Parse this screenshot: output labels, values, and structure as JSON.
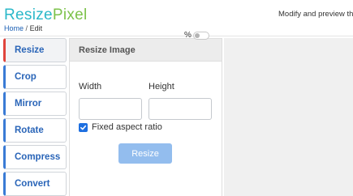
{
  "header": {
    "logo_part1": "Resize",
    "logo_part2": "Pixel",
    "tagline": "Modify and preview th",
    "breadcrumb": {
      "home": "Home",
      "separator": "/",
      "current": "Edit"
    }
  },
  "sidebar": {
    "items": [
      {
        "label": "Resize",
        "active": true
      },
      {
        "label": "Crop"
      },
      {
        "label": "Mirror"
      },
      {
        "label": "Rotate"
      },
      {
        "label": "Compress"
      },
      {
        "label": "Convert"
      }
    ]
  },
  "panel": {
    "title": "Resize Image",
    "percent_label": "%",
    "percent_toggle_on": false,
    "width_label": "Width",
    "height_label": "Height",
    "width_value": "",
    "height_value": "",
    "aspect_label": "Fixed aspect ratio",
    "aspect_checked": true,
    "button_label": "Resize"
  },
  "colors": {
    "logo_primary": "#2bb8c9",
    "logo_secondary": "#7cc24a",
    "tab_text": "#2a65b8",
    "active_indicator": "#e0443c",
    "button_bg": "#93bdee",
    "checkbox": "#1e6fe0"
  }
}
